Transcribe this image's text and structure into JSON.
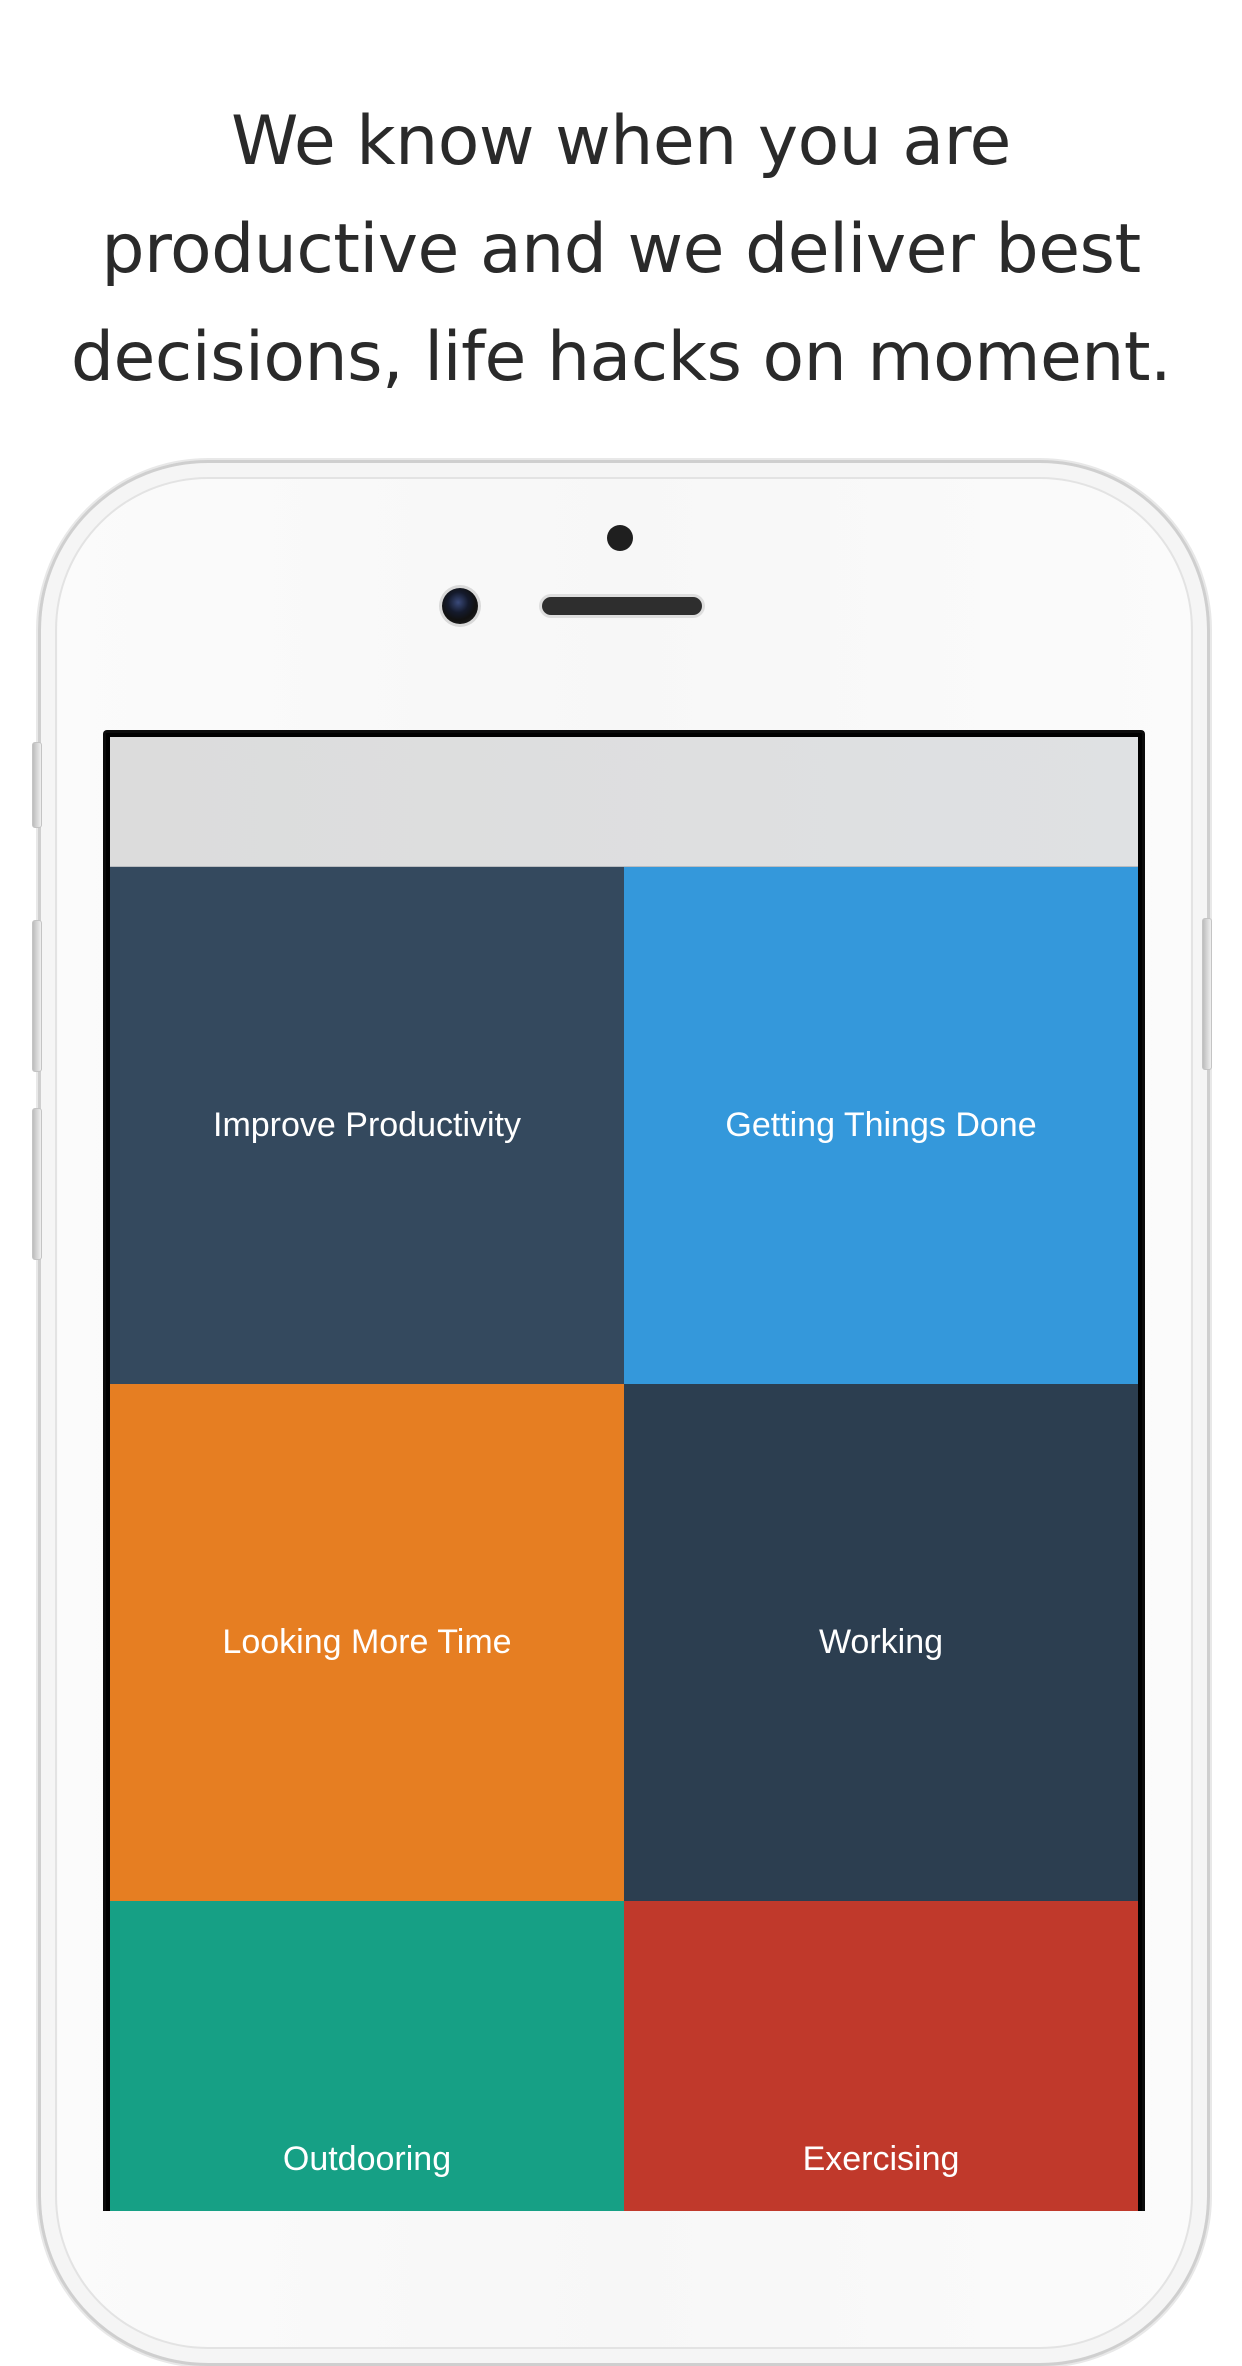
{
  "headline": {
    "lines": [
      "We know when you are",
      "productive and we deliver best",
      "decisions, life hacks on moment."
    ]
  },
  "categories": [
    {
      "label": "Improve Productivity",
      "color": "#34495e"
    },
    {
      "label": "Getting Things Done",
      "color": "#3498db"
    },
    {
      "label": "Looking More Time",
      "color": "#e67e22"
    },
    {
      "label": "Working",
      "color": "#2c3e50"
    },
    {
      "label": "Outdooring",
      "color": "#16a085"
    },
    {
      "label": "Exercising",
      "color": "#c0392b"
    }
  ]
}
